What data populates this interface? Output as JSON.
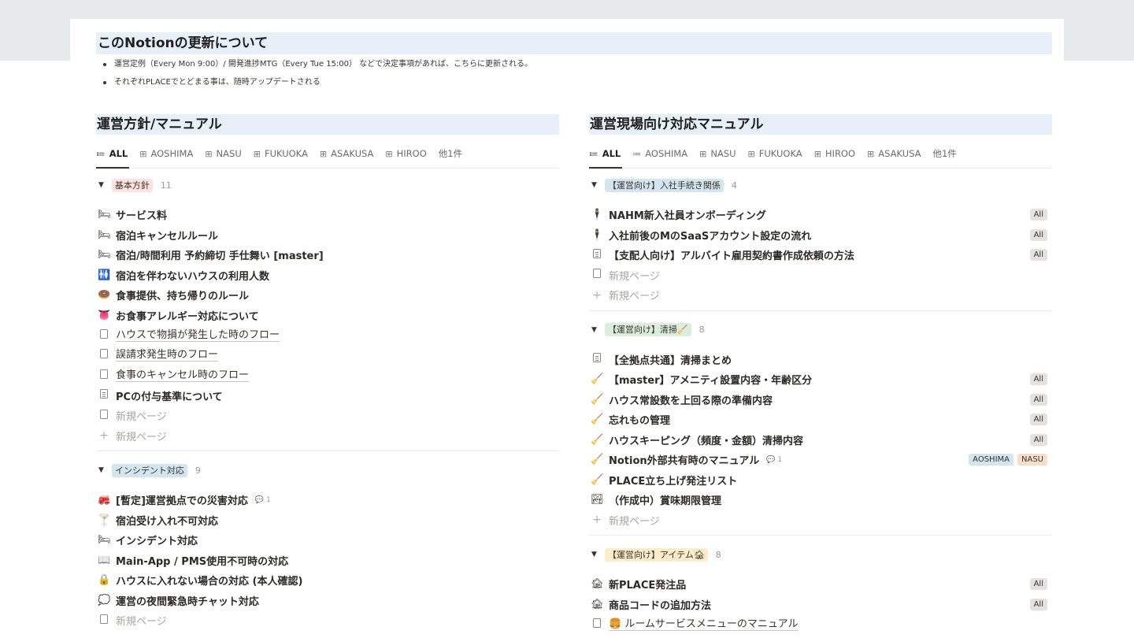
{
  "callout": {
    "title": "このNotionの更新について",
    "bullets": [
      "運営定例（Every Mon 9:00）/ 開発進捗MTG（Every Tue 15:00） などで決定事項があれば、こちらに更新される。",
      "それぞれPLACEでとどまる事は、随時アップデートされる"
    ]
  },
  "left": {
    "title": "運営方針/マニュアル",
    "tabs": [
      {
        "label": "ALL",
        "icon": "≔"
      },
      {
        "label": "AOSHIMA",
        "icon": "⊞"
      },
      {
        "label": "NASU",
        "icon": "⊞"
      },
      {
        "label": "FUKUOKA",
        "icon": "⊞"
      },
      {
        "label": "ASAKUSA",
        "icon": "⊞"
      },
      {
        "label": "HIROO",
        "icon": "⊞"
      },
      {
        "label": "他1件",
        "icon": ""
      }
    ],
    "groups": [
      {
        "tag": "基本方針",
        "tag_color": "#ffe2dd",
        "count": "11",
        "items": [
          {
            "icon": "🛏",
            "text": "サービス料"
          },
          {
            "icon": "🛏",
            "text": "宿泊キャンセルルール"
          },
          {
            "icon": "🛏",
            "text": "宿泊/時間利用 予約締切 手仕舞い [master]"
          },
          {
            "icon": "🚻",
            "text": "宿泊を伴わないハウスの利用人数"
          },
          {
            "icon": "🍩",
            "text": "食事提供、持ち帰りのルール"
          },
          {
            "icon": "👅",
            "text": "お食事アレルギー対応について"
          },
          {
            "icon": "doc",
            "text": "ハウスで物損が発生した時のフロー",
            "style": "ul"
          },
          {
            "icon": "doc",
            "text": "誤請求発生時のフロー",
            "style": "ul"
          },
          {
            "icon": "doc",
            "text": "食事のキャンセル時のフロー",
            "style": "ul"
          },
          {
            "icon": "doc-lines",
            "text": "PCの付与基準について"
          },
          {
            "icon": "doc",
            "text": "新規ページ",
            "style": "new"
          },
          {
            "icon": "plus",
            "text": "新規ページ",
            "style": "new"
          }
        ]
      },
      {
        "tag": "インシデント対応",
        "tag_color": "#d3e5ef",
        "count": "9",
        "items": [
          {
            "icon": "🚒",
            "text": "[暫定]運営拠点での災害対応",
            "comment": "1"
          },
          {
            "icon": "🍸",
            "text": "宿泊受け入れ不可対応"
          },
          {
            "icon": "🛏",
            "text": "インシデント対応"
          },
          {
            "icon": "📖",
            "text": "Main-App / PMS使用不可時の対応"
          },
          {
            "icon": "🔒",
            "text": "ハウスに入れない場合の対応 (本人確認)"
          },
          {
            "icon": "💭",
            "text": "運営の夜間緊急時チャット対応"
          },
          {
            "icon": "doc",
            "text": "新規ページ",
            "style": "new"
          }
        ]
      }
    ]
  },
  "right": {
    "title": "運営現場向け対応マニュアル",
    "tabs": [
      {
        "label": "ALL",
        "icon": "≔"
      },
      {
        "label": "AOSHIMA",
        "icon": "≔"
      },
      {
        "label": "NASU",
        "icon": "⊞"
      },
      {
        "label": "FUKUOKA",
        "icon": "⊞"
      },
      {
        "label": "HIROO",
        "icon": "⊞"
      },
      {
        "label": "ASAKUSA",
        "icon": "⊞"
      },
      {
        "label": "他1件",
        "icon": ""
      }
    ],
    "groups": [
      {
        "tag": "【運営向け】入社手続き関係",
        "tag_color": "#d3e5ef",
        "count": "4",
        "items": [
          {
            "icon": "🕴",
            "text": "NAHM新入社員オンボーディング",
            "tags": [
              "All"
            ]
          },
          {
            "icon": "🕴",
            "text": "入社前後のMのSaaSアカウント設定の流れ",
            "tags": [
              "All"
            ]
          },
          {
            "icon": "doc-lines",
            "text": "【支配人向け】アルバイト雇用契約書作成依頼の方法",
            "tags": [
              "All"
            ]
          },
          {
            "icon": "doc",
            "text": "新規ページ",
            "style": "new"
          },
          {
            "icon": "plus",
            "text": "新規ページ",
            "style": "new"
          }
        ]
      },
      {
        "tag": "【運営向け】清掃🧹",
        "tag_color": "#dbeddb",
        "count": "8",
        "items": [
          {
            "icon": "doc-lines",
            "text": "【全拠点共通】清掃まとめ"
          },
          {
            "icon": "🧹",
            "text": "【master】アメニティ設置内容・年齢区分",
            "tags": [
              "All"
            ]
          },
          {
            "icon": "🧹",
            "text": "ハウス常設数を上回る際の準備内容",
            "tags": [
              "All"
            ]
          },
          {
            "icon": "🧹",
            "text": "忘れもの管理",
            "tags": [
              "All"
            ]
          },
          {
            "icon": "🧹",
            "text": "ハウスキーピング（頻度・金額）清掃内容",
            "tags": [
              "All"
            ]
          },
          {
            "icon": "🧹",
            "text": "Notion外部共有時のマニュアル",
            "comment": "1",
            "tags": [
              "AOSHIMA",
              "NASU"
            ]
          },
          {
            "icon": "🧹",
            "text": "PLACE立ち上げ発注リスト"
          },
          {
            "icon": "🏞",
            "text": "（作成中）賞味期限管理"
          },
          {
            "icon": "plus",
            "text": "新規ページ",
            "style": "new"
          }
        ]
      },
      {
        "tag": "【運営向け】アイテム🏚",
        "tag_color": "#fdecc8",
        "count": "8",
        "items": [
          {
            "icon": "🏚",
            "text": "新PLACE発注品",
            "tags": [
              "All"
            ]
          },
          {
            "icon": "🏚",
            "text": "商品コードの追加方法",
            "tags": [
              "All"
            ]
          },
          {
            "icon": "doc",
            "text": "🍔 ルームサービスメニューのマニュアル",
            "style": "ul"
          }
        ]
      }
    ]
  }
}
